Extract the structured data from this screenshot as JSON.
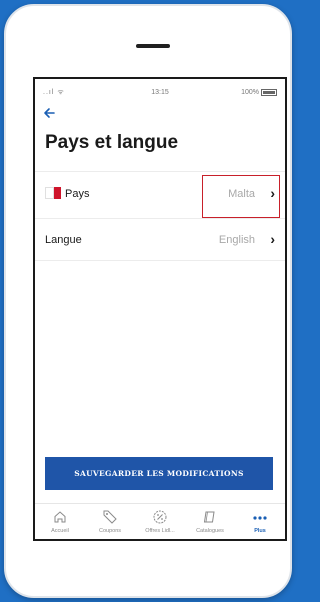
{
  "status": {
    "signal": "..ıl ᯤ",
    "time": "13:15",
    "battery": "100%"
  },
  "header": {
    "back_icon": "arrow-left-icon",
    "title": "Pays et langue"
  },
  "rows": [
    {
      "label": "Pays",
      "value": "Malta",
      "flag": "malta-flag-icon"
    },
    {
      "label": "Langue",
      "value": "English"
    }
  ],
  "chevron": "›",
  "save_label": "SAUVEGARDER LES MODIFICATIONS",
  "tabs": [
    {
      "label": "Accueil",
      "icon": "home-icon",
      "active": false
    },
    {
      "label": "Coupons",
      "icon": "coupon-icon",
      "active": false
    },
    {
      "label": "Offres Lidl...",
      "icon": "percent-badge-icon",
      "active": false
    },
    {
      "label": "Catalogues",
      "icon": "catalog-icon",
      "active": false
    },
    {
      "label": "Plus",
      "icon": "more-dots-icon",
      "active": true
    }
  ],
  "colors": {
    "accent": "#1a5fb4",
    "button": "#1f55a8",
    "highlight": "#c8202a",
    "background": "#1f6fc4"
  }
}
